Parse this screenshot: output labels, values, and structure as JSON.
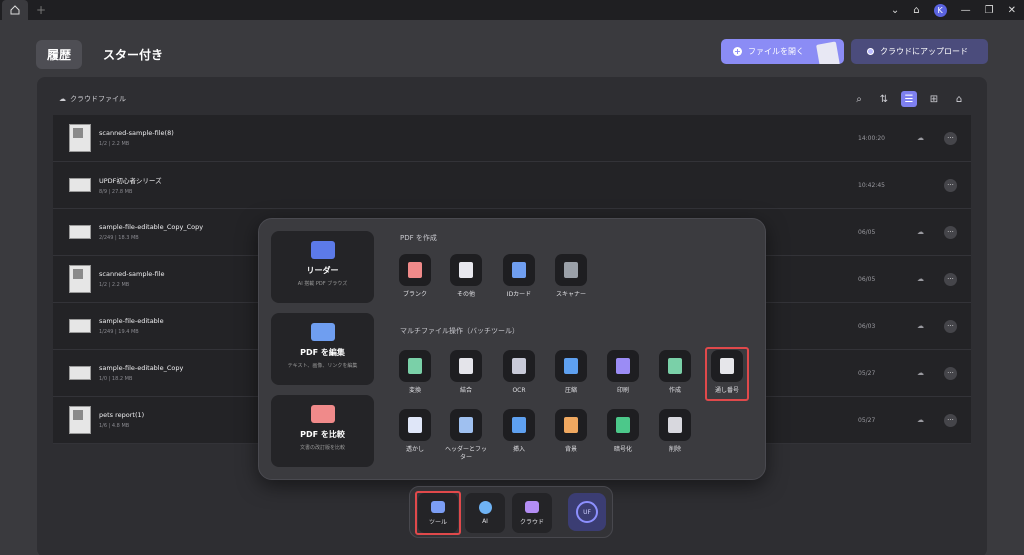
{
  "titlebar": {
    "avatar_initial": "K"
  },
  "header": {
    "tabs": [
      {
        "label": "履歴"
      },
      {
        "label": "スター付き"
      }
    ],
    "open_file_label": "ファイルを開く",
    "upload_cloud_label": "クラウドにアップロード"
  },
  "panel": {
    "breadcrumb": "クラウドファイル",
    "files": [
      {
        "name": "scanned-sample-file(8)",
        "meta": "1/2 | 2.2 MB",
        "date": "14:00:20"
      },
      {
        "name": "UPDF初心者シリーズ",
        "meta": "8/9 | 27.8 MB",
        "date": "10:42:45"
      },
      {
        "name": "sample-file-editable_Copy_Copy",
        "meta": "2/249 | 18.3 MB",
        "date": "06/05"
      },
      {
        "name": "scanned-sample-file",
        "meta": "1/2 | 2.2 MB",
        "date": "06/05"
      },
      {
        "name": "sample-file-editable",
        "meta": "1/249 | 19.4 MB",
        "date": "06/03"
      },
      {
        "name": "sample-file-editable_Copy",
        "meta": "1/0 | 18.2 MB",
        "date": "05/27"
      },
      {
        "name": "pets report(1)",
        "meta": "1/6 | 4.8 MB",
        "date": "05/27"
      }
    ]
  },
  "popup": {
    "cards": [
      {
        "title": "リーダー",
        "sub": "AI 搭載 PDF ブラウズ"
      },
      {
        "title": "PDF を編集",
        "sub": "テキスト、画像、リンクを編集"
      },
      {
        "title": "PDF を比較",
        "sub": "文書の改訂版を比較"
      }
    ],
    "create_title": "PDF を作成",
    "create_tools": [
      {
        "label": "ブランク",
        "color": "#f08a8a"
      },
      {
        "label": "その他",
        "color": "#e8e8ee"
      },
      {
        "label": "IDカード",
        "color": "#6f9ef0"
      },
      {
        "label": "スキャナー",
        "color": "#9aa0a8"
      }
    ],
    "batch_title": "マルチファイル操作（バッチツール）",
    "batch_tools_row1": [
      {
        "label": "変換",
        "color": "#7ad0a8"
      },
      {
        "label": "結合",
        "color": "#e4e4ea"
      },
      {
        "label": "OCR",
        "color": "#c8cad8"
      },
      {
        "label": "圧縮",
        "color": "#5ea0f0"
      },
      {
        "label": "印刷",
        "color": "#9b8cf5"
      },
      {
        "label": "作成",
        "color": "#7ad0a8"
      },
      {
        "label": "通し番号",
        "color": "#e6e6ea"
      }
    ],
    "batch_tools_row2": [
      {
        "label": "透かし",
        "color": "#dfe6f8"
      },
      {
        "label": "ヘッダーとフッ\nター",
        "color": "#9fc0f0"
      },
      {
        "label": "挿入",
        "color": "#5ea0f0"
      },
      {
        "label": "背景",
        "color": "#f0a860"
      },
      {
        "label": "暗号化",
        "color": "#4cc88a"
      },
      {
        "label": "削除",
        "color": "#d8d8de"
      }
    ]
  },
  "dock": {
    "items": [
      {
        "label": "ツール",
        "color": "#7c9ef5"
      },
      {
        "label": "AI",
        "color": "#6fb3f5"
      },
      {
        "label": "クラウド",
        "color": "#b48ef5"
      }
    ],
    "ai_glyph": "UF"
  }
}
